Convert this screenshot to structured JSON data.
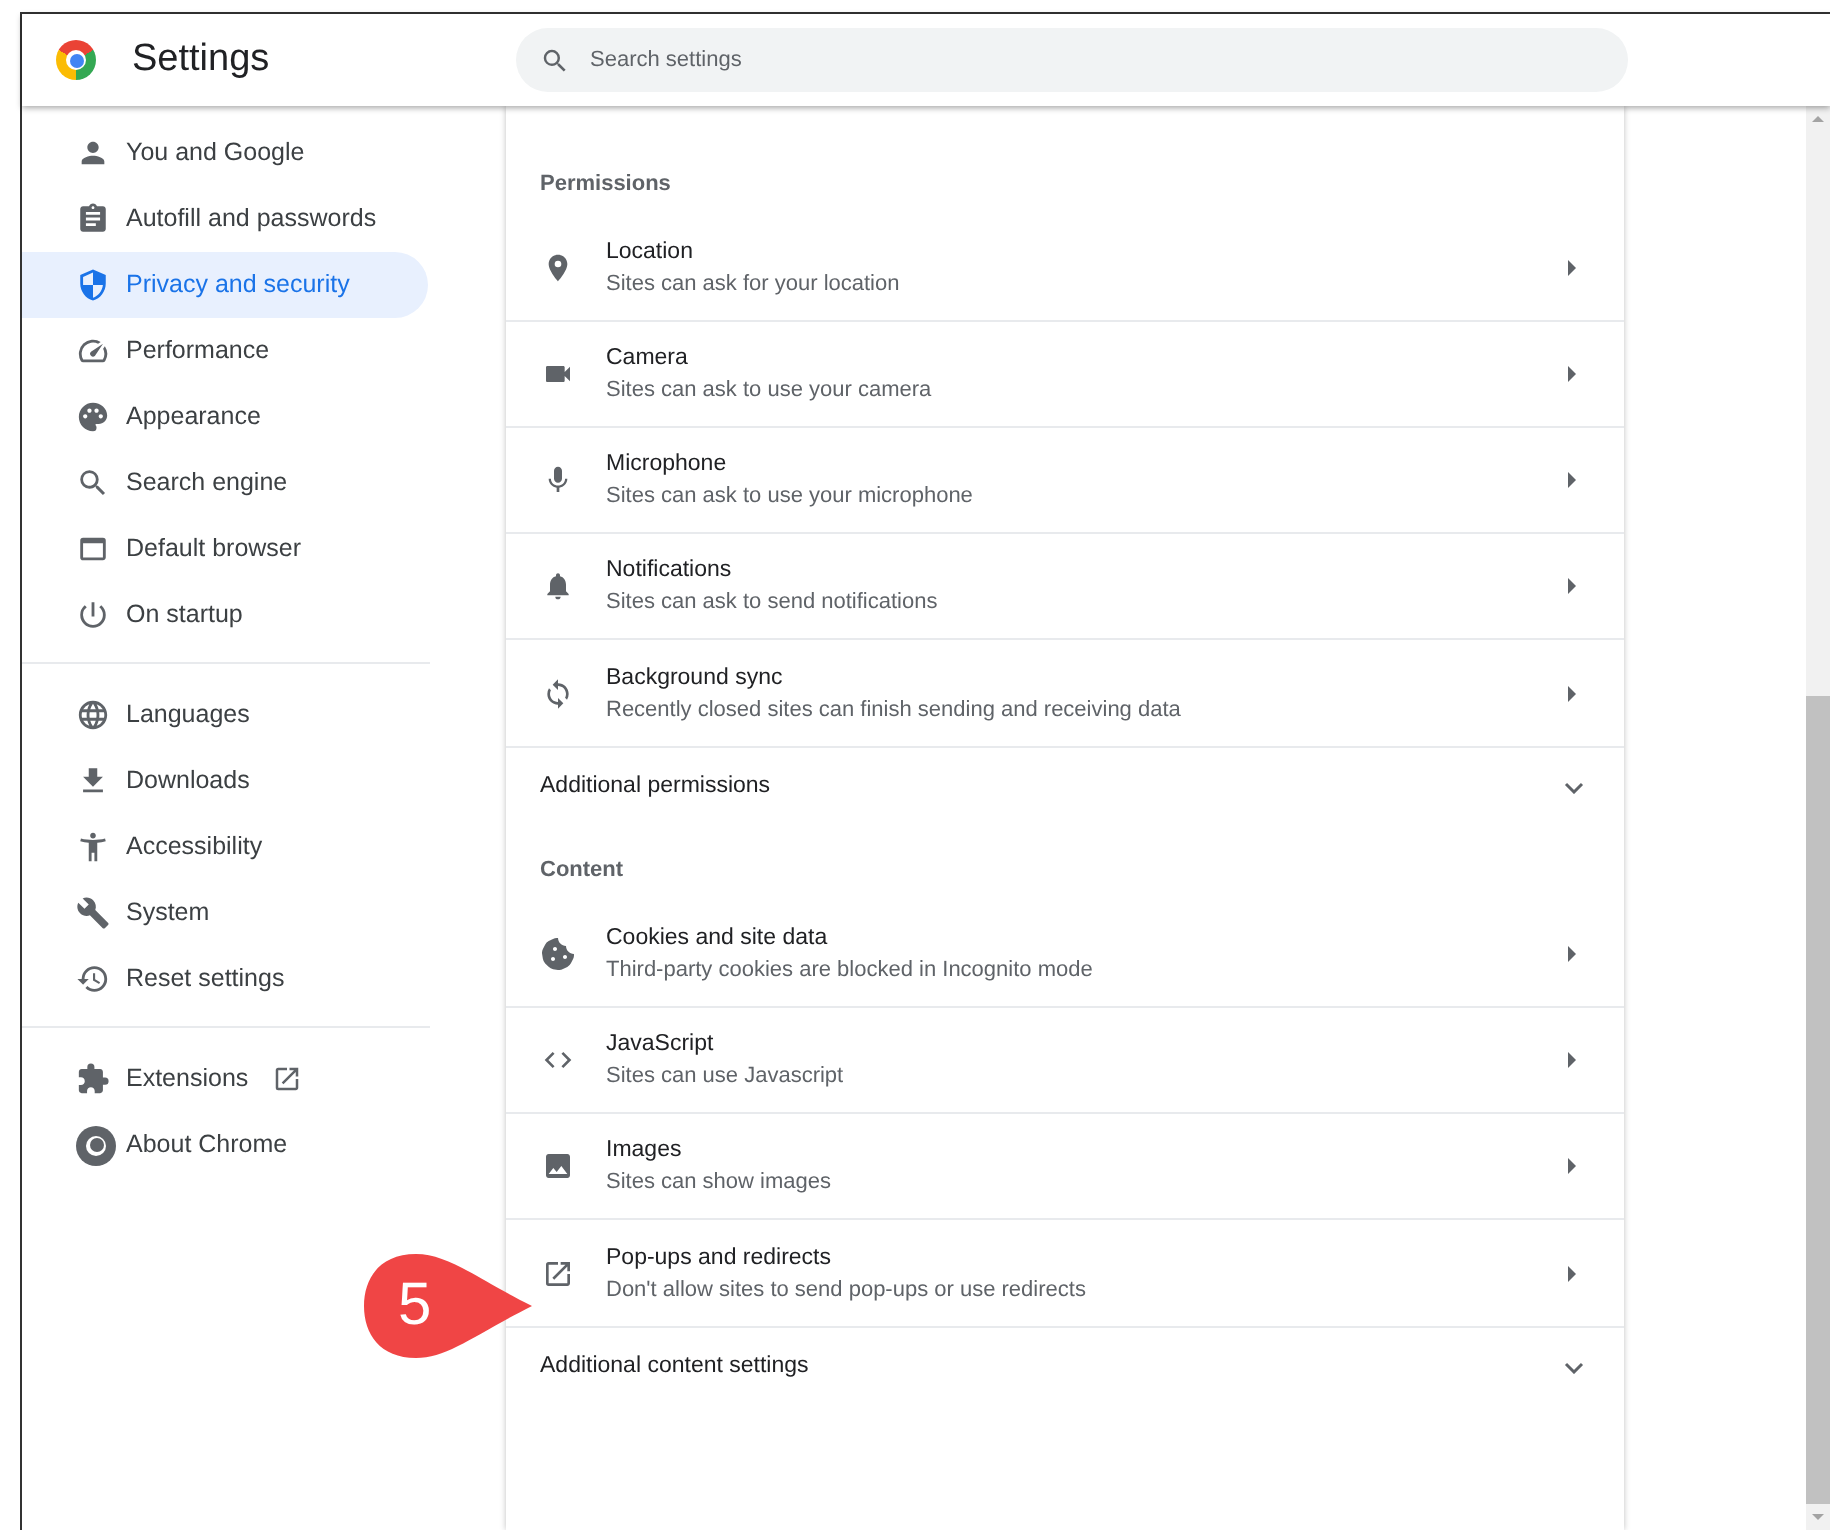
{
  "header": {
    "title": "Settings",
    "search": {
      "placeholder": "Search settings"
    }
  },
  "sidebar": {
    "groups": [
      [
        {
          "label": "You and Google",
          "selected": false,
          "external": false
        },
        {
          "label": "Autofill and passwords",
          "selected": false,
          "external": false
        },
        {
          "label": "Privacy and security",
          "selected": true,
          "external": false
        },
        {
          "label": "Performance",
          "selected": false,
          "external": false
        },
        {
          "label": "Appearance",
          "selected": false,
          "external": false
        },
        {
          "label": "Search engine",
          "selected": false,
          "external": false
        },
        {
          "label": "Default browser",
          "selected": false,
          "external": false
        },
        {
          "label": "On startup",
          "selected": false,
          "external": false
        }
      ],
      [
        {
          "label": "Languages",
          "selected": false,
          "external": false
        },
        {
          "label": "Downloads",
          "selected": false,
          "external": false
        },
        {
          "label": "Accessibility",
          "selected": false,
          "external": false
        },
        {
          "label": "System",
          "selected": false,
          "external": false
        },
        {
          "label": "Reset settings",
          "selected": false,
          "external": false
        }
      ],
      [
        {
          "label": "Extensions",
          "selected": false,
          "external": true
        },
        {
          "label": "About Chrome",
          "selected": false,
          "external": false
        }
      ]
    ]
  },
  "sections": [
    {
      "title": "Permissions",
      "rows": [
        {
          "title": "Location",
          "subtitle": "Sites can ask for your location"
        },
        {
          "title": "Camera",
          "subtitle": "Sites can ask to use your camera"
        },
        {
          "title": "Microphone",
          "subtitle": "Sites can ask to use your microphone"
        },
        {
          "title": "Notifications",
          "subtitle": "Sites can ask to send notifications"
        },
        {
          "title": "Background sync",
          "subtitle": "Recently closed sites can finish sending and receiving data"
        }
      ],
      "more": {
        "label": "Additional permissions",
        "expanded": false
      }
    },
    {
      "title": "Content",
      "rows": [
        {
          "title": "Cookies and site data",
          "subtitle": "Third-party cookies are blocked in Incognito mode"
        },
        {
          "title": "JavaScript",
          "subtitle": "Sites can use Javascript"
        },
        {
          "title": "Images",
          "subtitle": "Sites can show images"
        },
        {
          "title": "Pop-ups and redirects",
          "subtitle": "Don't allow sites to send pop-ups or use redirects"
        }
      ],
      "more": {
        "label": "Additional content settings",
        "expanded": false
      }
    }
  ],
  "callout": {
    "label": "5"
  }
}
